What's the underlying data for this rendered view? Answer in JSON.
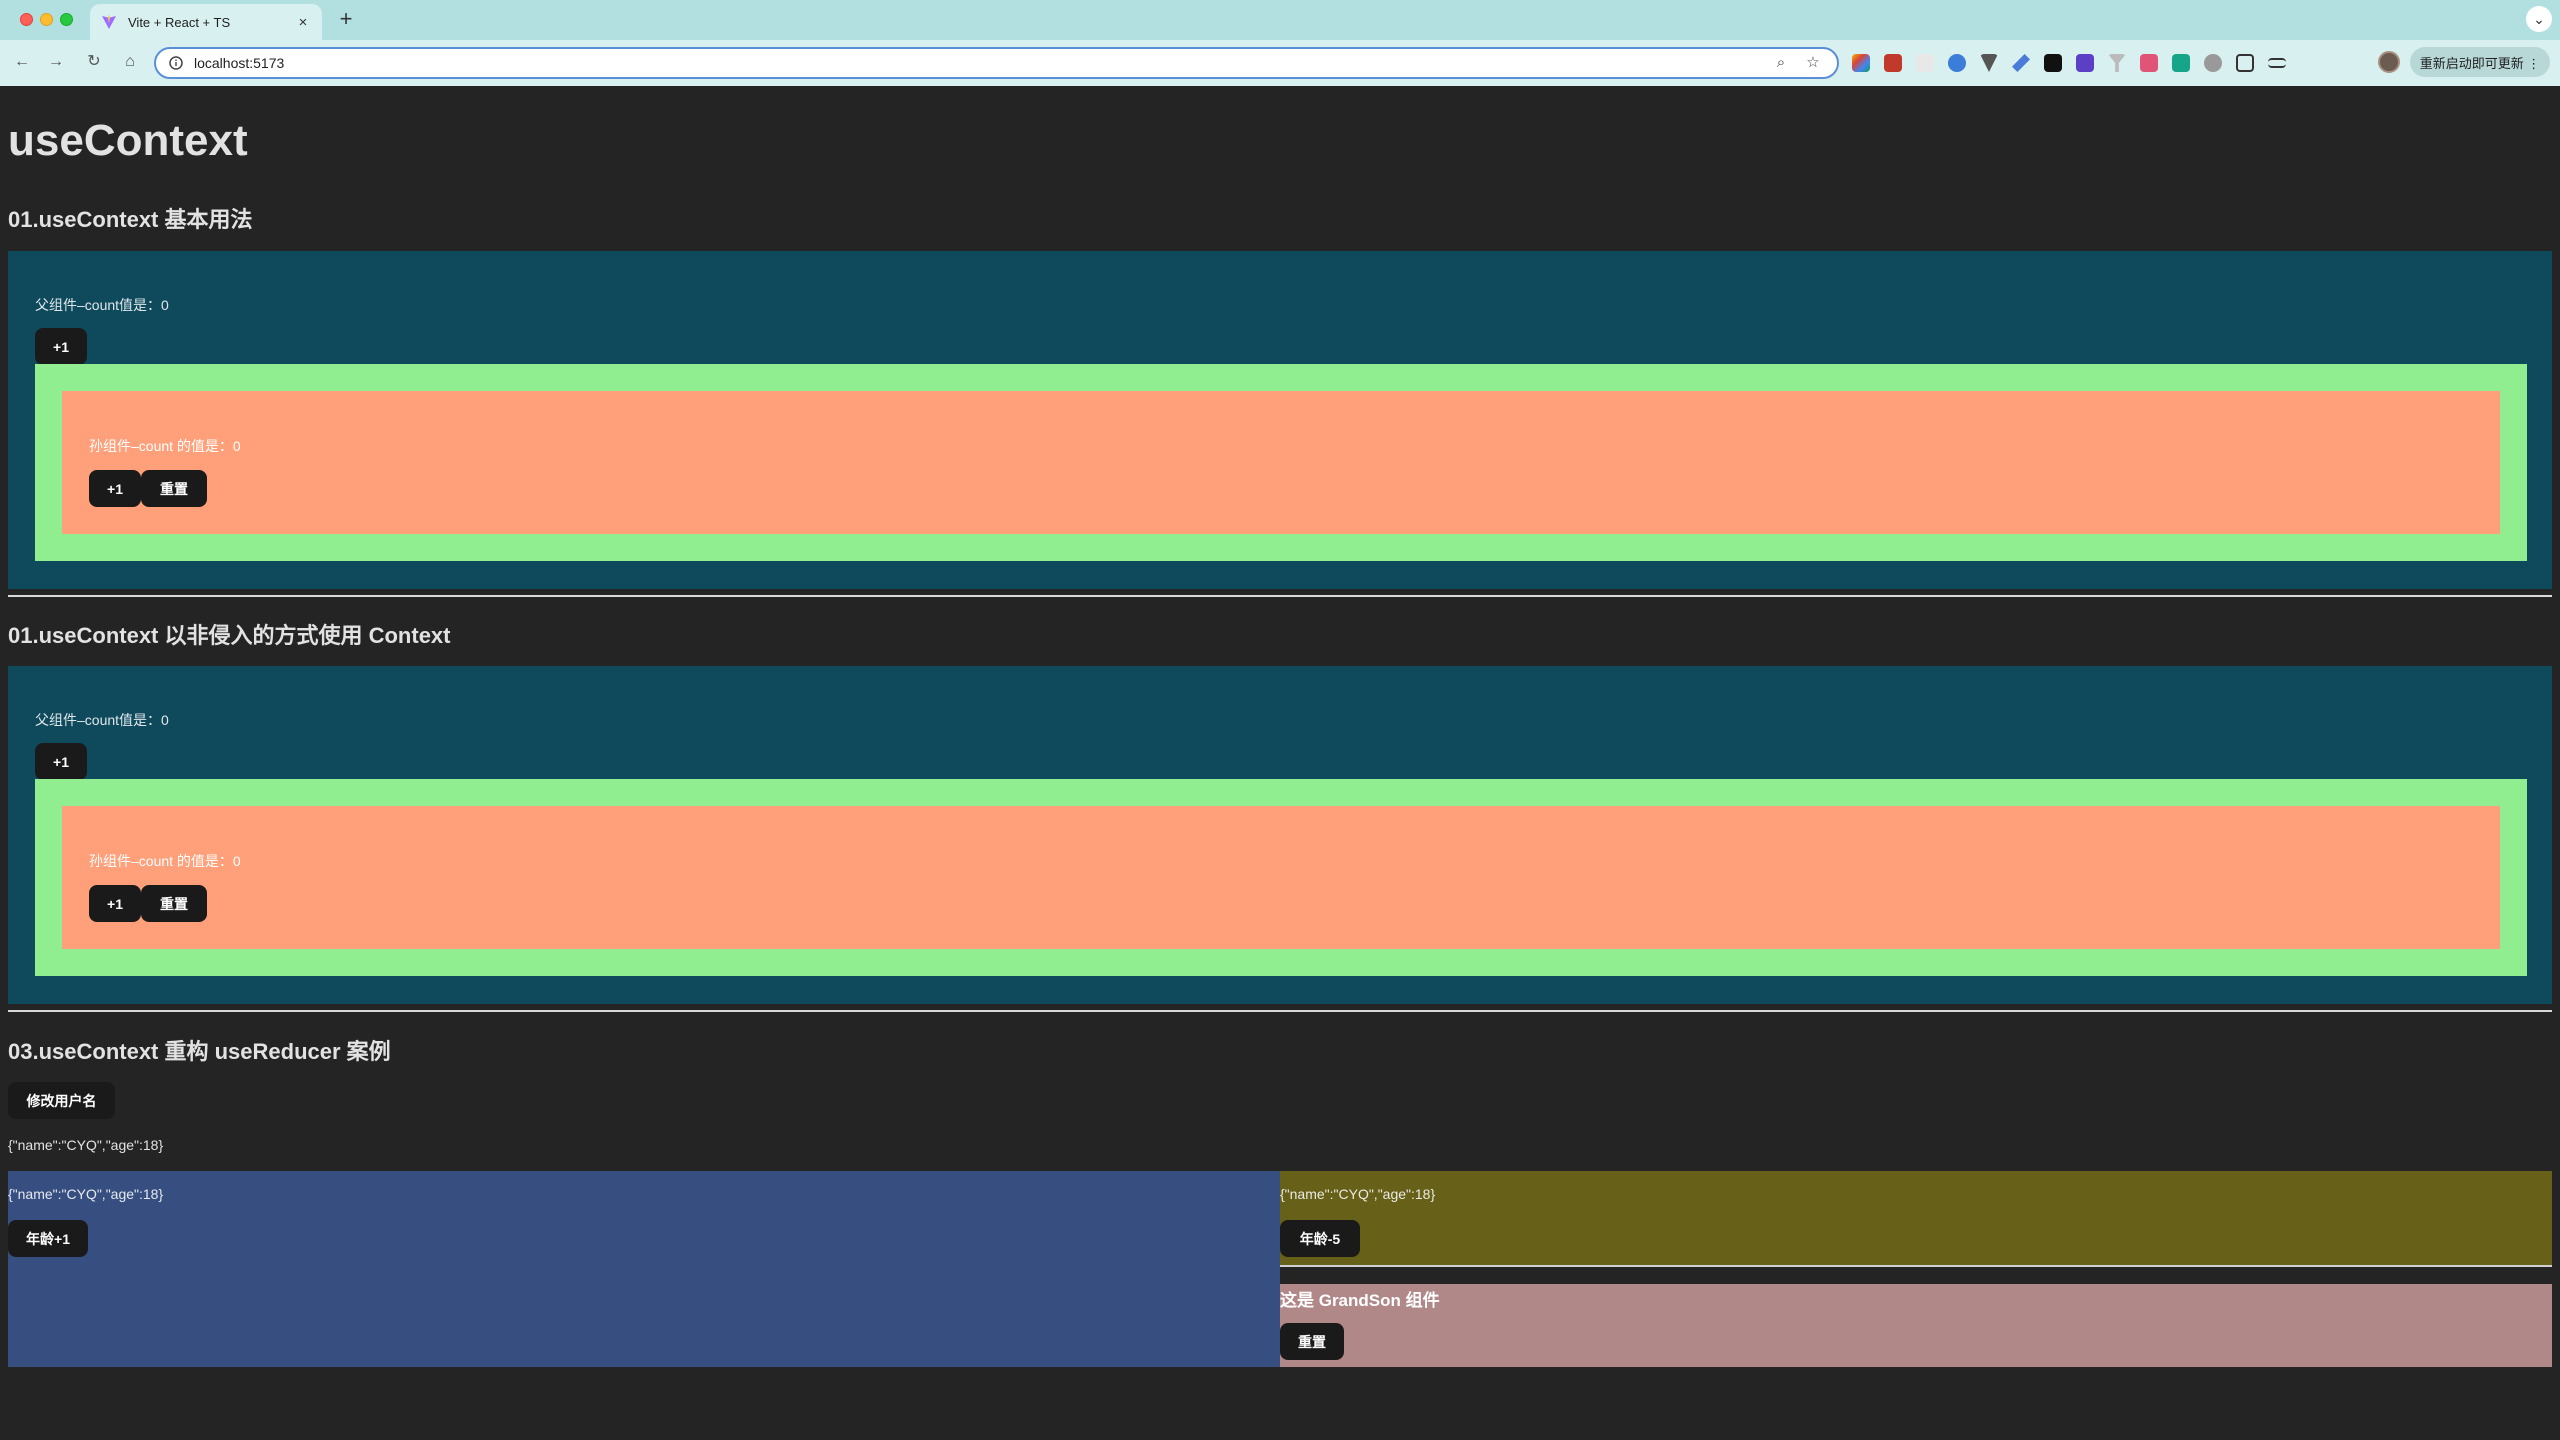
{
  "browser": {
    "tab_title": "Vite + React + TS",
    "new_tab": "+",
    "tab_close": "×",
    "url": "localhost:5173",
    "update_button": "重新启动即可更新 ⋮"
  },
  "page": {
    "title": "useContext",
    "section1": {
      "title": "01.useContext 基本用法",
      "parent_label": "父组件–count值是：0",
      "parent_button": "+1",
      "grand_label": "孙组件–count 的值是：0",
      "grand_add_button": "+1",
      "grand_reset_button": "重置"
    },
    "section2": {
      "title": "01.useContext 以非侵入的方式使用 Context",
      "parent_label": "父组件–count值是：0",
      "parent_button": "+1",
      "grand_label": "孙组件–count 的值是：0",
      "grand_add_button": "+1",
      "grand_reset_button": "重置"
    },
    "section3": {
      "title": "03.useContext 重构 useReducer 案例",
      "rename_button": "修改用户名",
      "state_json": "{\"name\":\"CYQ\",\"age\":18}",
      "left_json": "{\"name\":\"CYQ\",\"age\":18}",
      "left_button": "年龄+1",
      "right_json": "{\"name\":\"CYQ\",\"age\":18}",
      "right_button": "年龄-5",
      "grandson_title": "这是 GrandSon 组件",
      "grandson_button": "重置"
    }
  }
}
